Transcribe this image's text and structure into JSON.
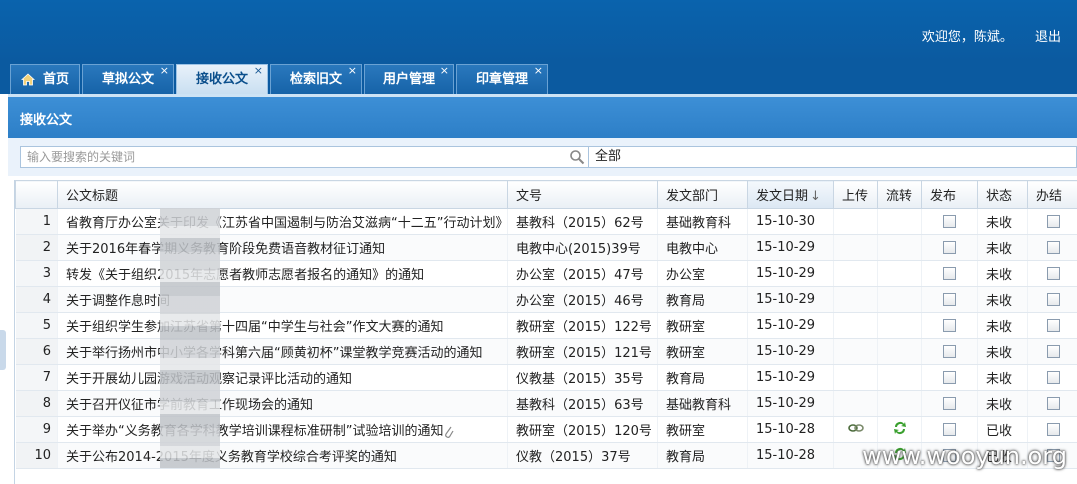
{
  "header": {
    "welcome": "欢迎您，陈斌。",
    "logout": "退出"
  },
  "tabs": [
    {
      "label": "首页",
      "icon": "home-icon"
    },
    {
      "label": "草拟公文"
    },
    {
      "label": "接收公文",
      "active": true
    },
    {
      "label": "检索旧文"
    },
    {
      "label": "用户管理"
    },
    {
      "label": "印章管理"
    }
  ],
  "close_glyph": "×",
  "panel": {
    "title": "接收公文"
  },
  "toolbar": {
    "search_placeholder": "输入要搜索的关键词",
    "filter_value": "全部"
  },
  "table": {
    "columns": [
      "公文标题",
      "文号",
      "发文部门",
      "发文日期",
      "上传",
      "流转",
      "发布",
      "状态",
      "办结"
    ],
    "sort_indicator": "↓",
    "rows": [
      {
        "n": "1",
        "title": "省教育厅办公室关于印发《江苏省中国遏制与防治艾滋病“十二五”行动计划》学校预防",
        "no": "基教科（2015）62号",
        "dept": "基础教育科",
        "date": "15-10-30",
        "status": "未收"
      },
      {
        "n": "2",
        "title": "关于2016年春学期义务教育阶段免费语音教材征订通知",
        "no": "电教中心(2015)39号",
        "dept": "电教中心",
        "date": "15-10-29",
        "status": "未收"
      },
      {
        "n": "3",
        "title": "转发《关于组织2015年志愿者教师志愿者报名的通知》的通知",
        "no": "办公室（2015）47号",
        "dept": "办公室",
        "date": "15-10-29",
        "status": "未收"
      },
      {
        "n": "4",
        "title": "关于调整作息时间",
        "no": "办公室（2015）46号",
        "dept": "教育局",
        "date": "15-10-29",
        "status": "未收"
      },
      {
        "n": "5",
        "title": "关于组织学生参加江苏省第十四届“中学生与社会”作文大赛的通知",
        "no": "教研室（2015）122号",
        "dept": "教研室",
        "date": "15-10-29",
        "status": "未收"
      },
      {
        "n": "6",
        "title": "关于举行扬州市中小学各学科第六届“顾黄初杯”课堂教学竞赛活动的通知",
        "no": "教研室（2015）121号",
        "dept": "教研室",
        "date": "15-10-29",
        "status": "未收"
      },
      {
        "n": "7",
        "title": "关于开展幼儿园游戏活动观察记录评比活动的通知",
        "no": "仪教基（2015）35号",
        "dept": "教育局",
        "date": "15-10-29",
        "status": "未收"
      },
      {
        "n": "8",
        "title": "关于召开仪征市学前教育工作现场会的通知",
        "no": "基教科（2015）63号",
        "dept": "基础教育科",
        "date": "15-10-29",
        "status": "未收"
      },
      {
        "n": "9",
        "title": "关于举办“义务教育各学科教学培训课程标准研制”试验培训的通知",
        "no": "教研室（2015）120号",
        "dept": "教研室",
        "date": "15-10-28",
        "status": "已收",
        "attach": true,
        "upload": true,
        "flow": true
      },
      {
        "n": "10",
        "title": "关于公布2014-2015年度义务教育学校综合考评奖的通知",
        "no": "仪教（2015）37号",
        "dept": "教育局",
        "date": "15-10-28",
        "status": "已收",
        "flow": true
      }
    ]
  },
  "watermark": "www.wooyun.org"
}
